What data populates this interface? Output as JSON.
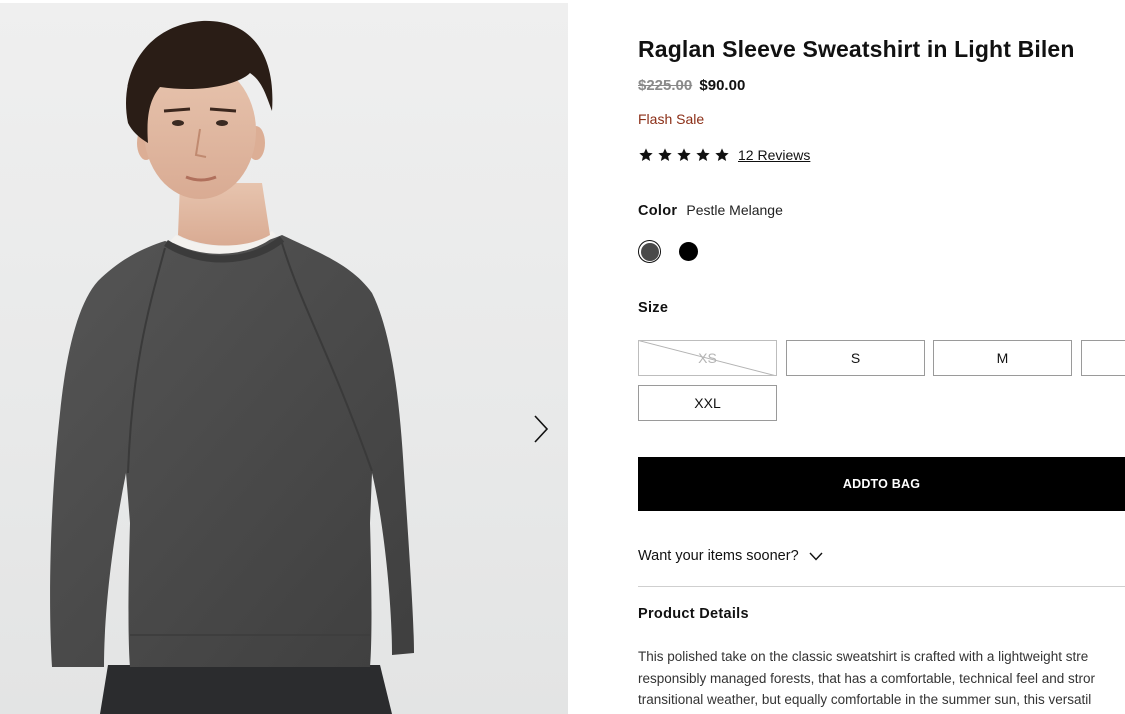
{
  "product": {
    "title": "Raglan Sleeve Sweatshirt in Light Bilen",
    "price_original": "$225.00",
    "price_sale": "$90.00",
    "sale_badge": "Flash Sale",
    "rating": 5,
    "reviews_link": "12 Reviews"
  },
  "color": {
    "label": "Color",
    "selected": "Pestle Melange",
    "swatches": [
      {
        "name": "Pestle Melange",
        "hex": "#4a4a4a",
        "selected": true
      },
      {
        "name": "Black",
        "hex": "#000000",
        "selected": false
      }
    ]
  },
  "size": {
    "label": "Size",
    "options": [
      {
        "label": "XS",
        "available": false
      },
      {
        "label": "S",
        "available": true
      },
      {
        "label": "M",
        "available": true
      },
      {
        "label": "",
        "available": true
      },
      {
        "label": "XXL",
        "available": true
      }
    ]
  },
  "cta": {
    "add_to_bag": "ADDTO BAG"
  },
  "delivery": {
    "prompt": "Want your items sooner?"
  },
  "details": {
    "heading": "Product Details",
    "lines": [
      "This polished take on the classic sweatshirt is crafted with a lightweight stre",
      "responsibly managed forests, that has a comfortable, technical feel and stror",
      "transitional weather, but equally comfortable in the summer sun, this versatil"
    ]
  },
  "icons": {
    "gallery_next": "chevron-right-icon",
    "rating_star": "star-icon",
    "delivery_toggle": "chevron-down-icon"
  },
  "colors": {
    "sale_text": "#8b2e16",
    "cta_bg": "#000000",
    "cta_text": "#ffffff",
    "sweater": "#4a4a4a",
    "gallery_bg": "#ececec"
  }
}
